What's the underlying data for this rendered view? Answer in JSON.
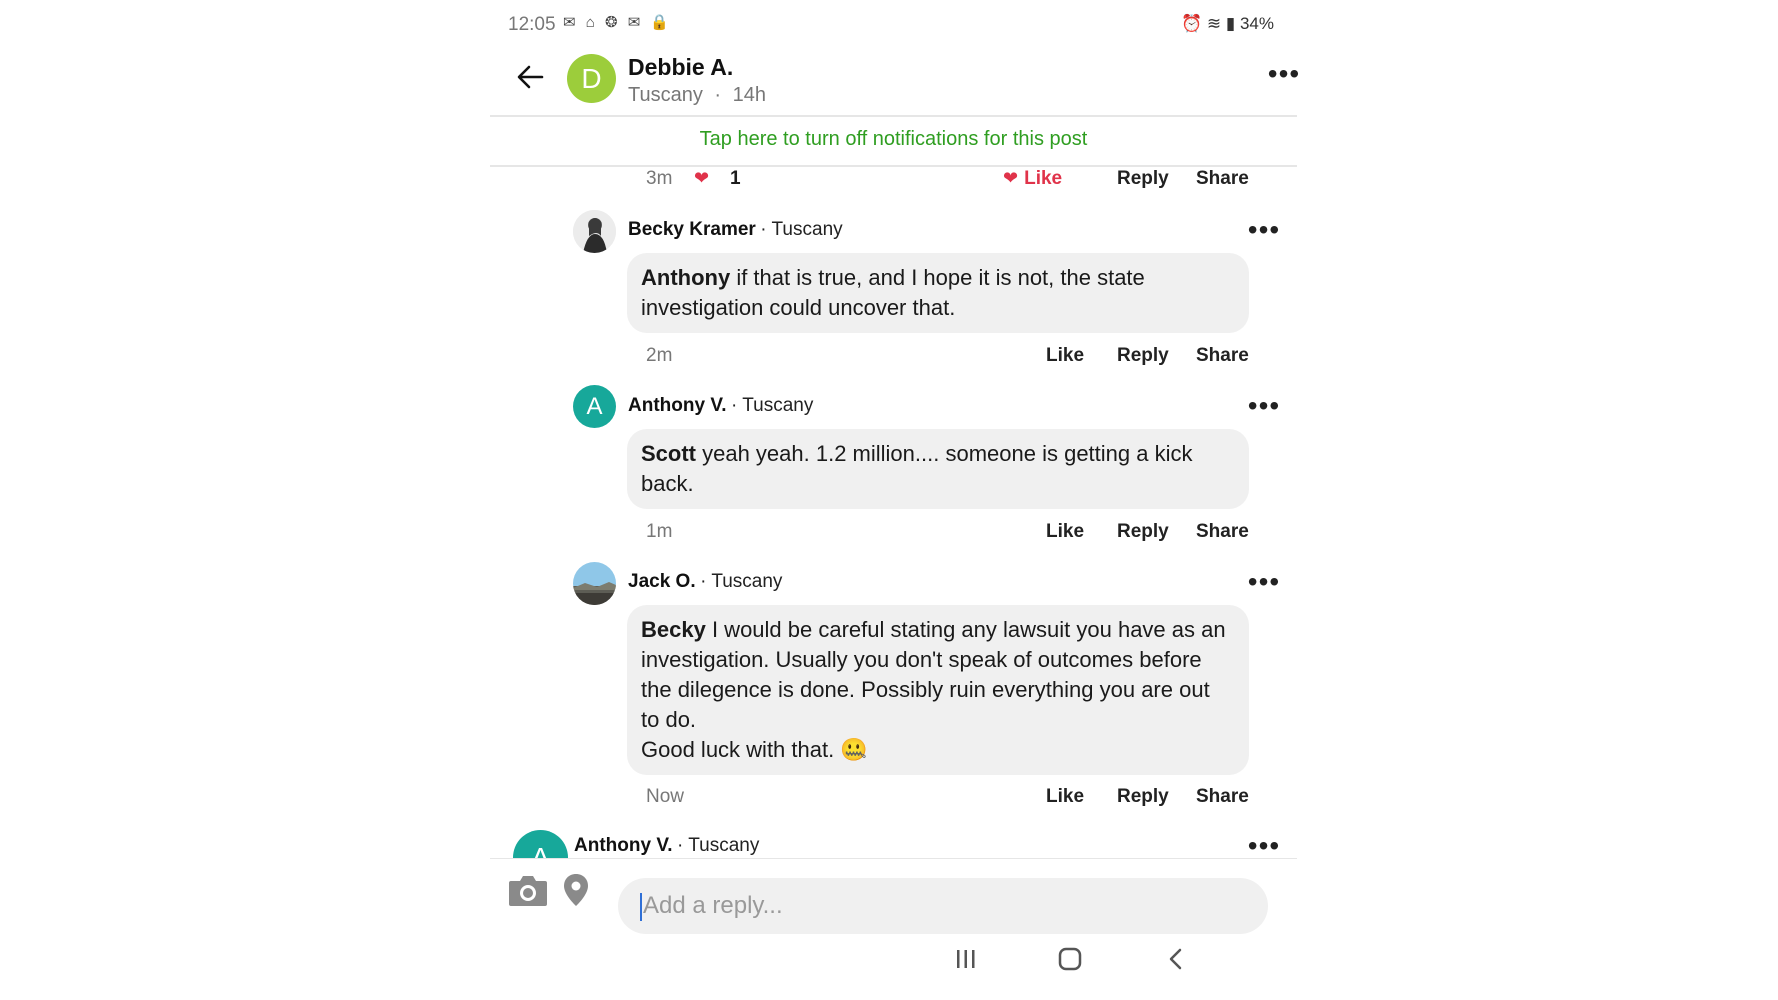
{
  "status_bar": {
    "time": "12:05",
    "left_icons": "✉ ⌂ ❂ ✉ 🔒",
    "right": "⏰ ≋ ▮ 34%"
  },
  "header": {
    "poster_initial": "D",
    "poster_name": "Debbie A.",
    "poster_location": "Tuscany",
    "separator": "·",
    "poster_time": "14h",
    "more": "•••"
  },
  "notification_banner": "Tap here to turn off notifications for this post",
  "top_comment_actions": {
    "time": "3m",
    "reaction_count": "1",
    "like": "Like",
    "reply": "Reply",
    "share": "Share"
  },
  "comments": [
    {
      "name": "Becky Kramer",
      "location": "· Tuscany",
      "mention": "Anthony",
      "text_line1": " if that is true, and I hope it is not, the state",
      "text_line2": "investigation could uncover that.",
      "time": "2m",
      "like": "Like",
      "reply": "Reply",
      "share": "Share"
    },
    {
      "initial": "A",
      "name": "Anthony V.",
      "location": "· Tuscany",
      "mention": "Scott",
      "text_line1": " yeah yeah.   1.2 million.... someone is getting a kick",
      "text_line2": "back.",
      "time": "1m",
      "like": "Like",
      "reply": "Reply",
      "share": "Share"
    },
    {
      "name": "Jack O.",
      "location": "· Tuscany",
      "mention": "Becky",
      "text_line1": " I would be careful stating any lawsuit you have as an",
      "text_line2": "investigation.   Usually you don't speak of outcomes before",
      "text_line3": "the dilegence is done.  Possibly ruin everything you are out",
      "text_line4": "to do.",
      "text_line5": " Good luck with that. 🤐",
      "time": "Now",
      "like": "Like",
      "reply": "Reply",
      "share": "Share"
    },
    {
      "initial": "A",
      "name": "Anthony V.",
      "location": "· Tuscany"
    }
  ],
  "reply_bar": {
    "placeholder": "Add a reply..."
  },
  "nav_bar": {
    "recents": "|||",
    "home": "▢",
    "back": "‹"
  },
  "colors": {
    "notification_green": "#2f9e21",
    "like_red": "#e0334a",
    "avatar_green": "#9ccd3b",
    "avatar_teal": "#17a89a"
  }
}
